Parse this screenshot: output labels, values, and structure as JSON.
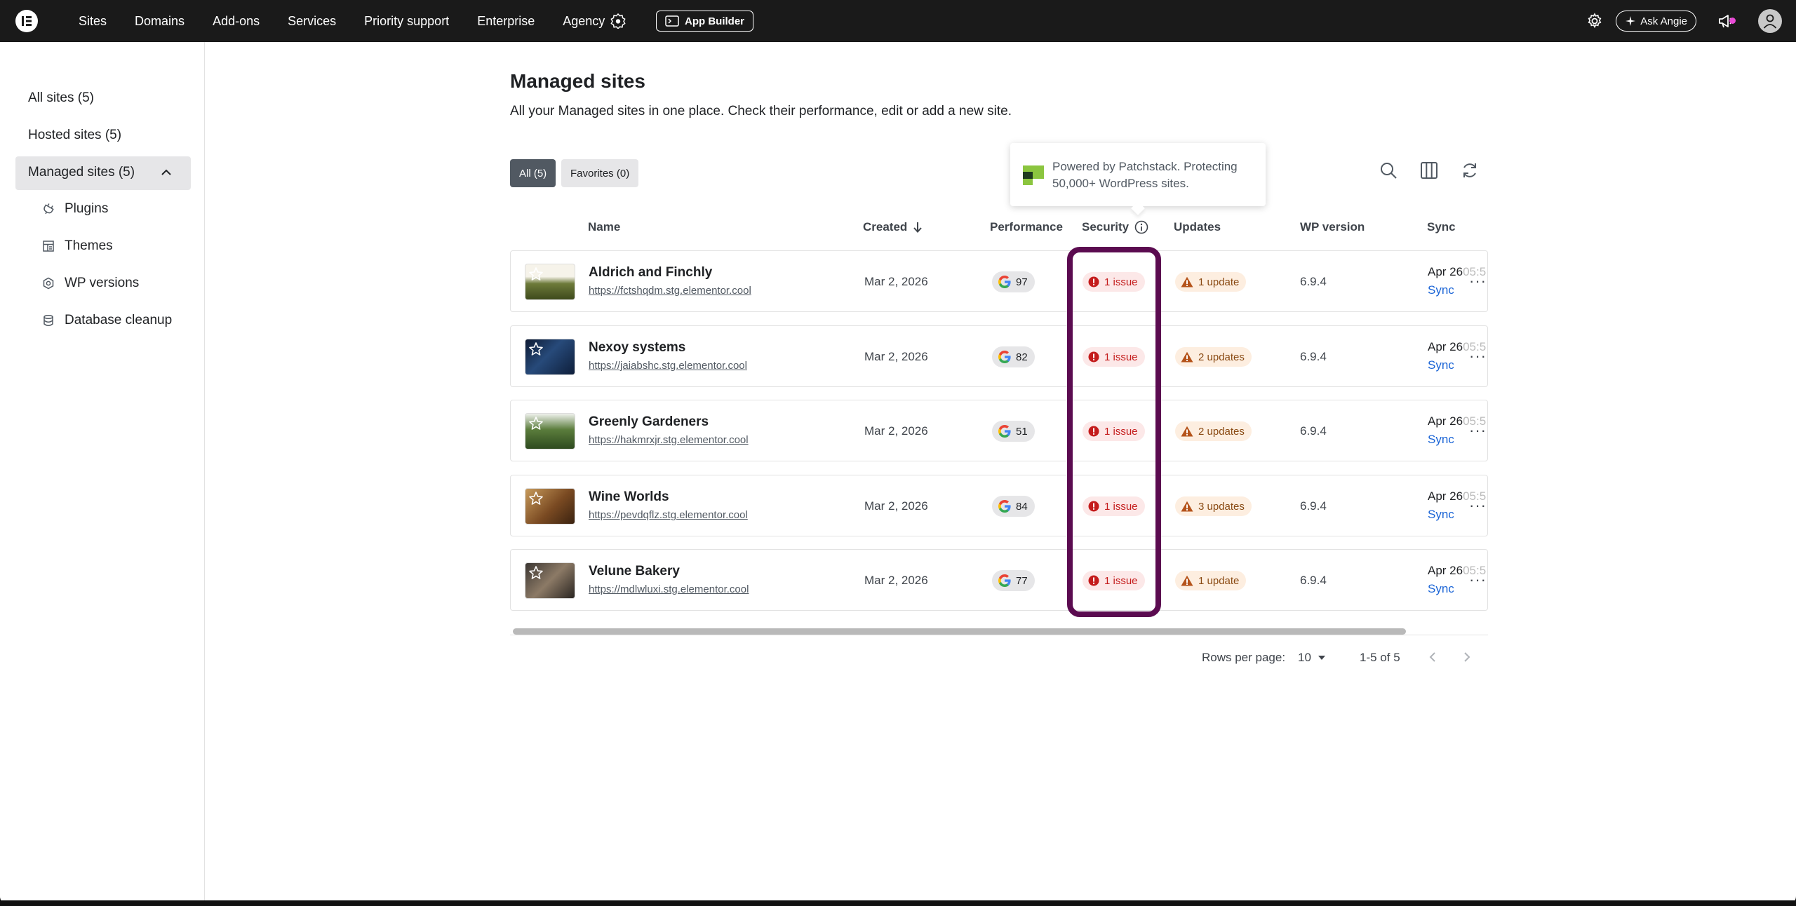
{
  "topbar": {
    "nav": [
      "Sites",
      "Domains",
      "Add-ons",
      "Services",
      "Priority support",
      "Enterprise",
      "Agency"
    ],
    "app_builder": "App Builder",
    "ask_angie": "Ask Angie"
  },
  "sidebar": {
    "items": [
      {
        "label": "All sites (5)"
      },
      {
        "label": "Hosted sites (5)"
      },
      {
        "label": "Managed sites (5)"
      }
    ],
    "subitems": [
      {
        "label": "Plugins",
        "icon": "plugin-icon"
      },
      {
        "label": "Themes",
        "icon": "themes-icon"
      },
      {
        "label": "WP versions",
        "icon": "wp-versions-icon"
      },
      {
        "label": "Database cleanup",
        "icon": "database-icon"
      }
    ]
  },
  "main": {
    "title": "Managed sites",
    "subtitle": "All your Managed sites in one place. Check their performance, edit or add a new site.",
    "filters": {
      "all": "All (5)",
      "favorites": "Favorites (0)"
    },
    "tooltip": "Powered by Patchstack. Protecting 50,000+ WordPress sites."
  },
  "table": {
    "columns": {
      "name": "Name",
      "created": "Created",
      "performance": "Performance",
      "security": "Security",
      "updates": "Updates",
      "wp_version": "WP version",
      "sync": "Sync"
    },
    "rows": [
      {
        "name": "Aldrich and Finchly",
        "url": "https://fctshqdm.stg.elementor.cool",
        "created": "Mar 2, 2026",
        "performance": "97",
        "security": "1 issue",
        "updates": "1 update",
        "wp_version": "6.9.4",
        "sync_date": "Apr 26",
        "sync_date_fade": "05:5",
        "sync_link": "Sync"
      },
      {
        "name": "Nexoy systems",
        "url": "https://jaiabshc.stg.elementor.cool",
        "created": "Mar 2, 2026",
        "performance": "82",
        "security": "1 issue",
        "updates": "2 updates",
        "wp_version": "6.9.4",
        "sync_date": "Apr 26",
        "sync_date_fade": "05:5",
        "sync_link": "Sync"
      },
      {
        "name": "Greenly Gardeners",
        "url": "https://hakmrxjr.stg.elementor.cool",
        "created": "Mar 2, 2026",
        "performance": "51",
        "security": "1 issue",
        "updates": "2 updates",
        "wp_version": "6.9.4",
        "sync_date": "Apr 26",
        "sync_date_fade": "05:5",
        "sync_link": "Sync"
      },
      {
        "name": "Wine Worlds",
        "url": "https://pevdqflz.stg.elementor.cool",
        "created": "Mar 2, 2026",
        "performance": "84",
        "security": "1 issue",
        "updates": "3 updates",
        "wp_version": "6.9.4",
        "sync_date": "Apr 26",
        "sync_date_fade": "05:5",
        "sync_link": "Sync"
      },
      {
        "name": "Velune Bakery",
        "url": "https://mdlwluxi.stg.elementor.cool",
        "created": "Mar 2, 2026",
        "performance": "77",
        "security": "1 issue",
        "updates": "1 update",
        "wp_version": "6.9.4",
        "sync_date": "Apr 26",
        "sync_date_fade": "05:5",
        "sync_link": "Sync"
      }
    ]
  },
  "pagination": {
    "rows_per_page_label": "Rows per page:",
    "rows_per_page_value": "10",
    "range": "1-5 of 5"
  },
  "colors": {
    "highlight": "#5b0b50",
    "security_text": "#c41c1c",
    "updates_text": "#8a4a13",
    "link": "#1a64d6"
  }
}
